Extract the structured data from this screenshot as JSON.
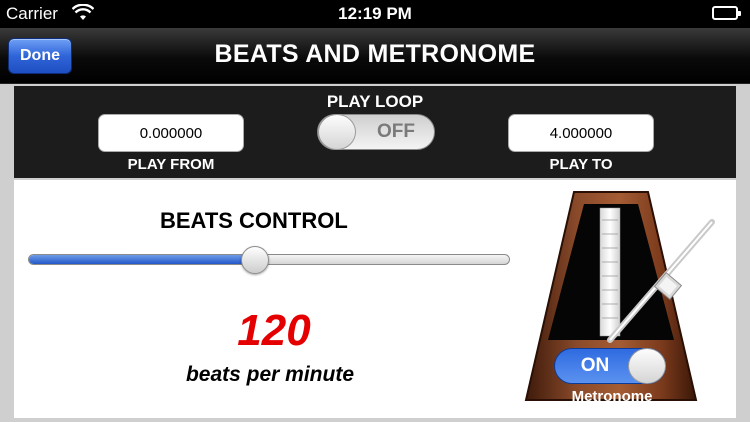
{
  "status_bar": {
    "carrier": "Carrier",
    "time": "12:19 PM"
  },
  "nav": {
    "done_label": "Done",
    "title": "BEATS AND METRONOME"
  },
  "loop": {
    "title": "PLAY LOOP",
    "switch_label": "OFF",
    "switch_on": false,
    "from_value": "0.000000",
    "from_label": "PLAY FROM",
    "to_value": "4.000000",
    "to_label": "PLAY TO"
  },
  "beats": {
    "title": "BEATS CONTROL",
    "slider_fraction": 0.47,
    "bpm": "120",
    "unit": "beats per minute"
  },
  "metronome": {
    "switch_label": "ON",
    "switch_on": true,
    "label": "Metronome"
  },
  "colors": {
    "accent_blue": "#2f64d8",
    "bpm_red": "#e40000",
    "wood": "#6b2f17"
  },
  "icons": {
    "wifi": "wifi-icon",
    "battery": "battery-icon",
    "metronome": "metronome-icon"
  }
}
